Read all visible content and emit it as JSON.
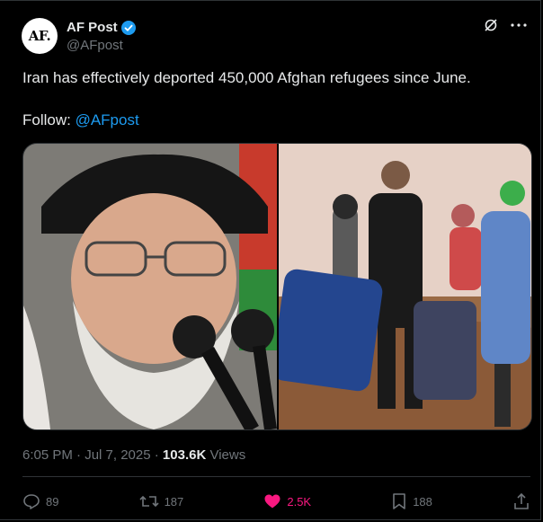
{
  "author": {
    "avatar_text": "AF.",
    "name": "AF Post",
    "handle": "@AFpost",
    "verified": true
  },
  "post": {
    "text": "Iran has effectively deported 450,000 Afghan refugees since June.",
    "follow_label": "Follow: ",
    "follow_handle": "@AFpost",
    "timestamp": "6:05 PM · Jul 7, 2025 · ",
    "views_count": "103.6K",
    "views_label": " Views"
  },
  "actions": {
    "replies": "89",
    "reposts": "187",
    "likes": "2.5K",
    "bookmarks": "188"
  },
  "media": {
    "left_image": "leader-portrait-with-microphones",
    "right_image": "refugees-walking-with-luggage"
  },
  "colors": {
    "background": "#000000",
    "text": "#e7e9ea",
    "muted": "#71767b",
    "link": "#1d9bf0",
    "like": "#f91880",
    "border": "#2f3336"
  }
}
